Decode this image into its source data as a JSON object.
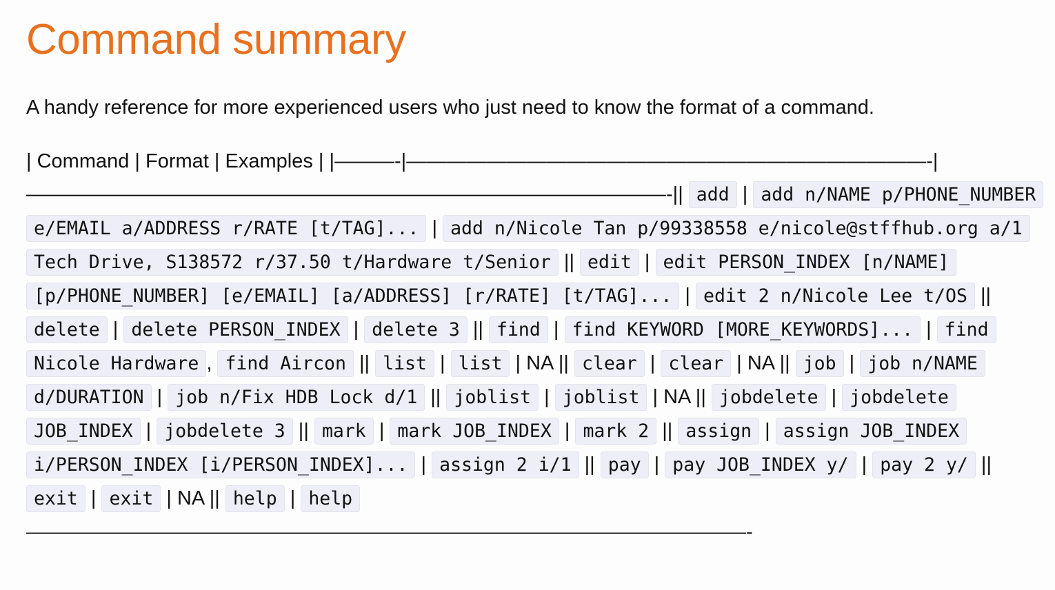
{
  "page_title": "Command summary",
  "intro": "A handy reference for more experienced users who just need to know the format of a command.",
  "header_row": "| Command | Format | Examples | |———-|——————————————————————————-| ————————————————————————————————-||",
  "segments": [
    {
      "t": "code",
      "v": "add"
    },
    {
      "t": "text",
      "v": " | "
    },
    {
      "t": "code",
      "v": "add n/NAME p/PHONE_NUMBER e/EMAIL a/ADDRESS r/RATE [t/TAG]..."
    },
    {
      "t": "text",
      "v": " | "
    },
    {
      "t": "code",
      "v": "add n/Nicole Tan p/99338558 e/nicole@stffhub.org a/1 Tech Drive, S138572 r/37.50 t/Hardware t/Senior"
    },
    {
      "t": "text",
      "v": " || "
    },
    {
      "t": "code",
      "v": "edit"
    },
    {
      "t": "text",
      "v": " | "
    },
    {
      "t": "code",
      "v": "edit PERSON_INDEX [n/NAME] [p/PHONE_NUMBER] [e/EMAIL] [a/ADDRESS] [r/RATE] [t/TAG]..."
    },
    {
      "t": "text",
      "v": " | "
    },
    {
      "t": "code",
      "v": "edit 2 n/Nicole Lee t/OS"
    },
    {
      "t": "text",
      "v": " || "
    },
    {
      "t": "code",
      "v": "delete"
    },
    {
      "t": "text",
      "v": " | "
    },
    {
      "t": "code",
      "v": "delete PERSON_INDEX"
    },
    {
      "t": "text",
      "v": " | "
    },
    {
      "t": "code",
      "v": "delete 3"
    },
    {
      "t": "text",
      "v": " || "
    },
    {
      "t": "code",
      "v": "find"
    },
    {
      "t": "text",
      "v": " | "
    },
    {
      "t": "code",
      "v": "find KEYWORD [MORE_KEYWORDS]..."
    },
    {
      "t": "text",
      "v": " | "
    },
    {
      "t": "code",
      "v": "find Nicole Hardware"
    },
    {
      "t": "text",
      "v": ", "
    },
    {
      "t": "code",
      "v": "find Aircon"
    },
    {
      "t": "text",
      "v": " || "
    },
    {
      "t": "code",
      "v": "list"
    },
    {
      "t": "text",
      "v": " | "
    },
    {
      "t": "code",
      "v": "list"
    },
    {
      "t": "text",
      "v": " | NA || "
    },
    {
      "t": "code",
      "v": "clear"
    },
    {
      "t": "text",
      "v": " | "
    },
    {
      "t": "code",
      "v": "clear"
    },
    {
      "t": "text",
      "v": " | NA || "
    },
    {
      "t": "code",
      "v": "job"
    },
    {
      "t": "text",
      "v": " | "
    },
    {
      "t": "code",
      "v": "job n/NAME d/DURATION"
    },
    {
      "t": "text",
      "v": " | "
    },
    {
      "t": "code",
      "v": "job n/Fix HDB Lock d/1"
    },
    {
      "t": "text",
      "v": " || "
    },
    {
      "t": "code",
      "v": "joblist"
    },
    {
      "t": "text",
      "v": " | "
    },
    {
      "t": "code",
      "v": "joblist"
    },
    {
      "t": "text",
      "v": " | NA || "
    },
    {
      "t": "code",
      "v": "jobdelete"
    },
    {
      "t": "text",
      "v": " | "
    },
    {
      "t": "code",
      "v": "jobdelete JOB_INDEX"
    },
    {
      "t": "text",
      "v": " | "
    },
    {
      "t": "code",
      "v": "jobdelete 3"
    },
    {
      "t": "text",
      "v": " || "
    },
    {
      "t": "code",
      "v": "mark"
    },
    {
      "t": "text",
      "v": " | "
    },
    {
      "t": "code",
      "v": "mark JOB_INDEX"
    },
    {
      "t": "text",
      "v": " | "
    },
    {
      "t": "code",
      "v": "mark 2"
    },
    {
      "t": "text",
      "v": " || "
    },
    {
      "t": "code",
      "v": "assign"
    },
    {
      "t": "text",
      "v": " | "
    },
    {
      "t": "code",
      "v": "assign JOB_INDEX i/PERSON_INDEX [i/PERSON_INDEX]..."
    },
    {
      "t": "text",
      "v": " | "
    },
    {
      "t": "code",
      "v": "assign 2 i/1"
    },
    {
      "t": "text",
      "v": " || "
    },
    {
      "t": "code",
      "v": "pay"
    },
    {
      "t": "text",
      "v": " | "
    },
    {
      "t": "code",
      "v": "pay JOB_INDEX y/"
    },
    {
      "t": "text",
      "v": " | "
    },
    {
      "t": "code",
      "v": "pay 2 y/"
    },
    {
      "t": "text",
      "v": " || "
    },
    {
      "t": "code",
      "v": "exit"
    },
    {
      "t": "text",
      "v": " | "
    },
    {
      "t": "code",
      "v": "exit"
    },
    {
      "t": "text",
      "v": " | NA || "
    },
    {
      "t": "code",
      "v": "help"
    },
    {
      "t": "text",
      "v": " | "
    },
    {
      "t": "code",
      "v": "help"
    },
    {
      "t": "text",
      "v": " ————————————————————————————————————-"
    }
  ]
}
